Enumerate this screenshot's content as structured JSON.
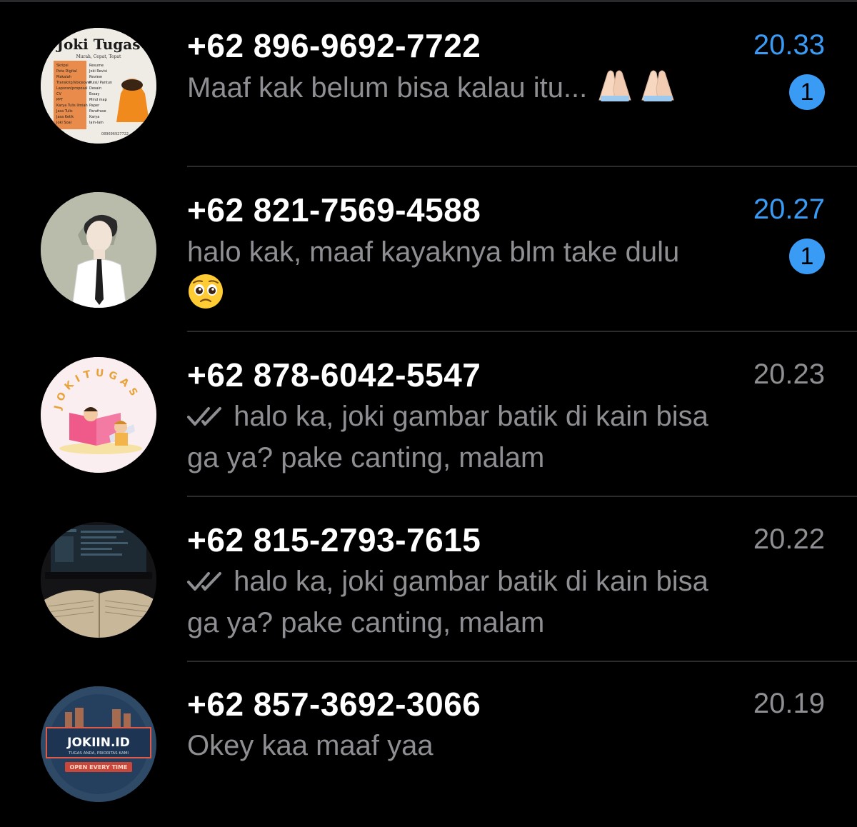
{
  "chats": [
    {
      "name": "+62 896-9692-7722",
      "time": "20.33",
      "preview": "Maaf kak belum bisa kalau itu...",
      "unread_count": "1",
      "avatar": {
        "title": "Joki Tugas",
        "subtitle": "Murah, Cepat, Tepat",
        "left_items": [
          "Skripsi",
          "Peta Digital",
          "Makalah",
          "Transkrip/Voiceover",
          "Laporan/proposal",
          "CV",
          "PPT",
          "Karya Tulis Ilmiah",
          "Jasa Tulis",
          "Jasa Ketik",
          "Joki Soal"
        ],
        "right_items": [
          "Resume",
          "Joki Revisi",
          "Review",
          "Puisi/ Pantun",
          "Desain",
          "Essay",
          "Mind map",
          "Paper",
          "Parafrase",
          "Karya",
          "lain-lain"
        ],
        "phone": "089696927722"
      }
    },
    {
      "name": "+62 821-7569-4588",
      "time": "20.27",
      "preview": "halo kak, maaf kayaknya blm take dulu",
      "unread_count": "1"
    },
    {
      "name": "+62 878-6042-5547",
      "time": "20.23",
      "preview": "halo ka, joki gambar batik di kain bisa ga ya? pake canting, malam",
      "avatar": {
        "arc_text": "JOKITUGAS"
      }
    },
    {
      "name": "+62 815-2793-7615",
      "time": "20.22",
      "preview": "halo ka, joki gambar batik di kain bisa ga ya? pake canting, malam"
    },
    {
      "name": "+62 857-3692-3066",
      "time": "20.19",
      "preview": "Okey kaa maaf yaa",
      "avatar": {
        "brand": "JOKIIN.ID",
        "tagline": "TUGAS ANDA, PRIORITAS KAMI",
        "ribbon": "OPEN EVERY TIME"
      }
    }
  ],
  "colors": {
    "background": "#000000",
    "name_text": "#ffffff",
    "secondary_text": "#8e8e93",
    "unread_accent": "#3a9bf5",
    "separator": "#2c2c2e"
  },
  "icons": {
    "read_receipt": "double-check-icon",
    "emoji_pray": "folded-hands-emoji",
    "emoji_pleading": "pleading-face-emoji"
  }
}
